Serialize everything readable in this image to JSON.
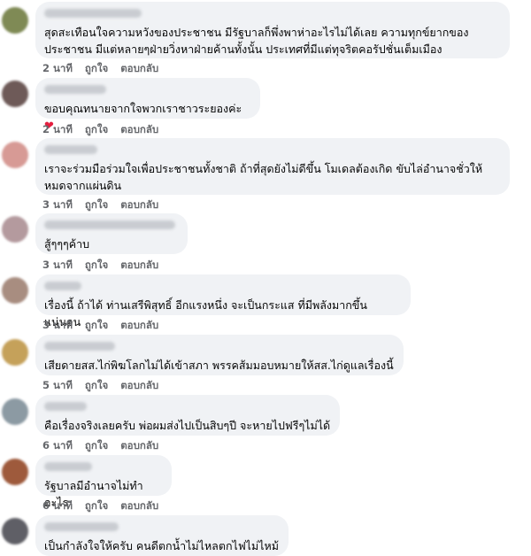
{
  "comments": [
    {
      "text": "สุดสะเทือนใจความหวังของประชาชน มีรัฐบาลก็พึ่งพาห่าอะไรไม่ได้เลย ความทุกข์ยากของประชาชน มีแต่หลายๆฝ่ายวิ่งหาฝ่ายค้านทั้งนั้น ประเทศที่มีแต่ทุจริตคอรัปชั่นเต็มเมือง",
      "time": "2 นาที",
      "like": "ถูกใจ",
      "reply": "ตอบกลับ"
    },
    {
      "text": "ขอบคุณทนายจากใจพวกเราชาวระยองค่ะ",
      "heart": "❤",
      "time": "2 นาที",
      "like": "ถูกใจ",
      "reply": "ตอบกลับ"
    },
    {
      "text": "เราจะร่วมมือร่วมใจเพื่อประชาชนทั้งชาติ ถ้าที่สุดยังไม่ดีขึ้น โมเดลต้องเกิด ขับไล่อำนาจชั่วให้หมดจากแผ่นดิน",
      "time": "3 นาที",
      "like": "ถูกใจ",
      "reply": "ตอบกลับ"
    },
    {
      "text": "สู้ๆๆๆค้าบ",
      "time": "3 นาที",
      "like": "ถูกใจ",
      "reply": "ตอบกลับ"
    },
    {
      "text": "เรื่องนี้ ถ้าได้ ท่านเสรีพิสุทธิ์ อีกแรงหนึ่ง จะเป็นกระแส ที่มีพลังมากขึ้นแน่นอน",
      "time": "3 นาที",
      "like": "ถูกใจ",
      "reply": "ตอบกลับ"
    },
    {
      "text": "เสียดายสส.ไก่พิฆโลกไม่ได้เข้าสภา พรรคส้มมอบหมายให้สส.ไก่ดูแลเรื่องนี้",
      "time": "5 นาที",
      "like": "ถูกใจ",
      "reply": "ตอบกลับ"
    },
    {
      "text": "คือเรื่องจริงเลยครับ พ่อผมส่งไปเป็นสิบๆปี จะหายไปฟรีๆไม่ได้",
      "time": "6 นาที",
      "like": "ถูกใจ",
      "reply": "ตอบกลับ"
    },
    {
      "text": "รัฐบาลมีอำนาจไม่ทำอะไร",
      "time": "6 นาที",
      "like": "ถูกใจ",
      "reply": "ตอบกลับ"
    },
    {
      "text": "เป็นกำลังใจให้ครับ คนดีตกน้ำไม่ไหลตกไฟไม่ไหม้"
    }
  ],
  "colors": {
    "bubble": "#f0f2f5",
    "meta": "#65676b",
    "heart": "#e41e3f"
  }
}
